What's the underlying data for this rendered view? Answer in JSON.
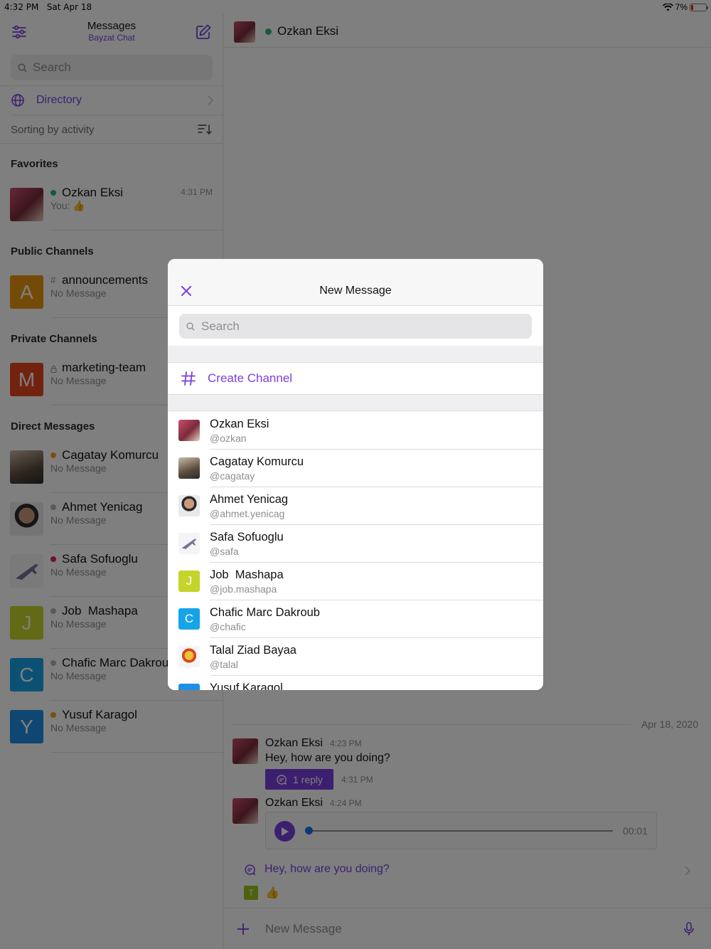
{
  "status_bar": {
    "time": "4:32 PM",
    "date": "Sat Apr 18",
    "battery": "7%"
  },
  "sidebar": {
    "title": "Messages",
    "subtitle": "Bayzat Chat",
    "search_placeholder": "Search",
    "directory_label": "Directory",
    "sort_label": "Sorting by activity",
    "sections": {
      "favorites": "Favorites",
      "public": "Public Channels",
      "private": "Private Channels",
      "direct": "Direct Messages"
    },
    "favorites": [
      {
        "name": "Ozkan Eksi",
        "last": "You: 👍",
        "time": "4:31 PM",
        "status_color": "#2bb673"
      }
    ],
    "public_channels": [
      {
        "name": "announcements",
        "last": "No Message",
        "initial": "A",
        "color": "#e8960c"
      }
    ],
    "private_channels": [
      {
        "name": "marketing-team",
        "last": "No Message",
        "initial": "M",
        "color": "#e5461f"
      }
    ],
    "direct_messages": [
      {
        "name": "Cagatay Komurcu",
        "last": "No Message",
        "status_color": "#f3a12c"
      },
      {
        "name": "Ahmet Yenicag",
        "last": "No Message",
        "status_color": "#b5b5b8"
      },
      {
        "name": "Safa Sofuoglu",
        "last": "No Message",
        "status_color": "#e0245e"
      },
      {
        "name": "Job  Mashapa",
        "last": "No Message",
        "initial": "J",
        "color": "#c4d42a",
        "status_color": "#b5b5b8"
      },
      {
        "name": "Chafic Marc Dakroub",
        "last": "No Message",
        "initial": "C",
        "color": "#17a3e8",
        "status_color": "#b5b5b8"
      },
      {
        "name": "Yusuf Karagol",
        "last": "No Message",
        "initial": "Y",
        "color": "#1f8fe5",
        "status_color": "#f3a12c"
      }
    ]
  },
  "chat": {
    "header_name": "Ozkan Eksi",
    "date_divider": "Apr 18, 2020",
    "messages": [
      {
        "author": "Ozkan Eksi",
        "time": "4:23 PM",
        "text": "Hey, how are you doing?",
        "reply_label": "1 reply",
        "reply_time": "4:31 PM"
      },
      {
        "author": "Ozkan Eksi",
        "time": "4:24 PM",
        "audio_duration": "00:01"
      }
    ],
    "thread_preview": "Hey, how are you doing?",
    "thread_reply_initial": "T",
    "thread_reply_text": "👍",
    "composer_placeholder": "New Message"
  },
  "modal": {
    "title": "New Message",
    "search_placeholder": "Search",
    "create_channel": "Create Channel",
    "users": [
      {
        "name": "Ozkan Eksi",
        "handle": "@ozkan",
        "avatar": "photo"
      },
      {
        "name": "Cagatay Komurcu",
        "handle": "@cagatay",
        "avatar": "photo"
      },
      {
        "name": "Ahmet Yenicag",
        "handle": "@ahmet.yenicag",
        "avatar": "photo"
      },
      {
        "name": "Safa Sofuoglu",
        "handle": "@safa",
        "avatar": "photo"
      },
      {
        "name": "Job  Mashapa",
        "handle": "@job.mashapa",
        "initial": "J",
        "color": "#c4d42a"
      },
      {
        "name": "Chafic Marc Dakroub",
        "handle": "@chafic",
        "initial": "C",
        "color": "#17a3e8"
      },
      {
        "name": "Talal Ziad Bayaa",
        "handle": "@talal",
        "avatar": "photo"
      },
      {
        "name": "Yusuf Karagol",
        "handle": "",
        "initial": "",
        "color": "#1f8fe5"
      }
    ]
  },
  "colors": {
    "accent": "#7a3fe0",
    "online": "#2bb673"
  }
}
